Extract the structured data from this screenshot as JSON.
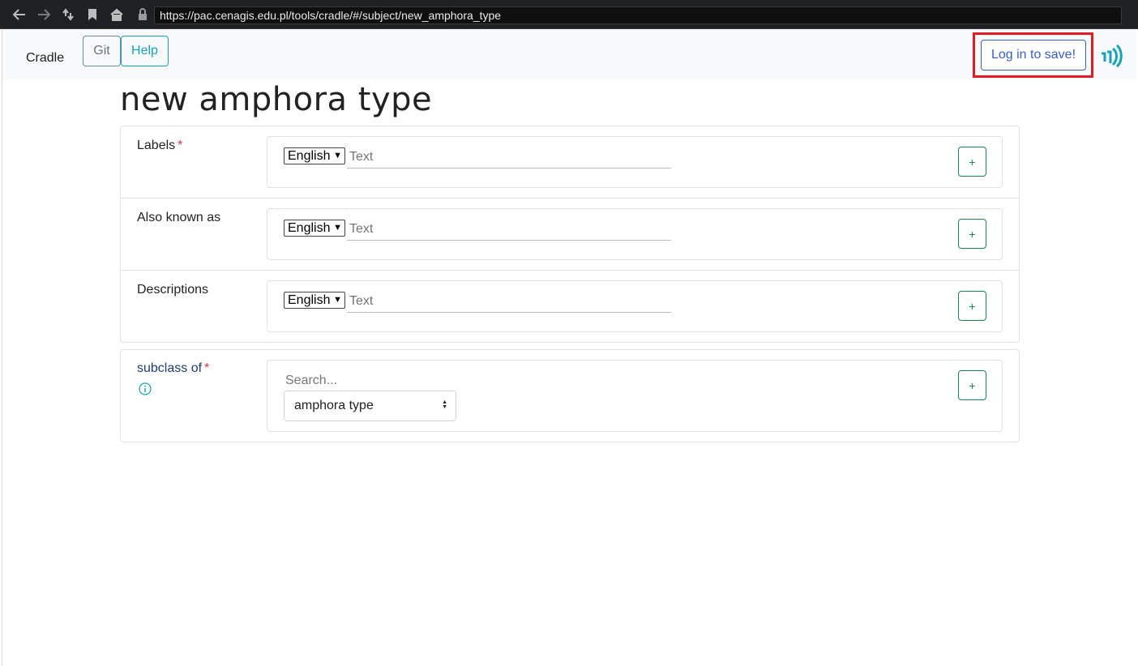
{
  "browser": {
    "url": "https://pac.cenagis.edu.pl/tools/cradle/#/subject/new_amphora_type"
  },
  "navbar": {
    "brand": "Cradle",
    "git_label": "Git",
    "help_label": "Help",
    "login_label": "Log in to save!"
  },
  "page": {
    "title": "new amphora type"
  },
  "fields": [
    {
      "label": "Labels",
      "required": "*",
      "language": "English",
      "placeholder": "Text",
      "add_label": "+"
    },
    {
      "label": "Also known as",
      "language": "English",
      "placeholder": "Text",
      "add_label": "+"
    },
    {
      "label": "Descriptions",
      "language": "English",
      "placeholder": "Text",
      "add_label": "+"
    }
  ],
  "subclass": {
    "label": "subclass of",
    "required": "*",
    "search_placeholder": "Search...",
    "selected": "amphora type",
    "add_label": "+"
  },
  "colors": {
    "accent_teal": "#17a2b8",
    "highlight_red": "#e01b24",
    "login_blue": "#3a5fc4",
    "add_green": "#198754"
  }
}
